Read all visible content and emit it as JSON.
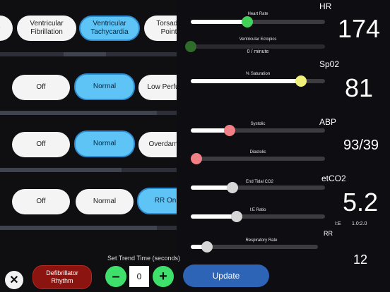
{
  "rhythm_row": {
    "options": [
      {
        "label": ")",
        "selected": false
      },
      {
        "label": "Ventricular\nFibrillation",
        "selected": false
      },
      {
        "label": "Ventricular\nTachycardia",
        "selected": true
      },
      {
        "label": "Torsade\nPoint",
        "selected": false
      }
    ]
  },
  "spo2_row": {
    "options": [
      {
        "label": "Off",
        "selected": false
      },
      {
        "label": "Normal",
        "selected": true
      },
      {
        "label": "Low Perfu",
        "selected": false
      }
    ]
  },
  "abp_row": {
    "options": [
      {
        "label": "Off",
        "selected": false
      },
      {
        "label": "Normal",
        "selected": true
      },
      {
        "label": "Overdam",
        "selected": false
      }
    ]
  },
  "co2_row": {
    "options": [
      {
        "label": "Off",
        "selected": false
      },
      {
        "label": "Normal",
        "selected": false
      },
      {
        "label": "RR On",
        "selected": true
      }
    ]
  },
  "vitals": {
    "hr": {
      "name": "HR",
      "value": "174",
      "slider_label": "Heart Rate",
      "slider_level": 0.42,
      "thumb_color": "#43d15a"
    },
    "ectopics": {
      "slider_label": "Ventricular Ectopics",
      "slider_level": 0.0,
      "readout": "0  / minute",
      "thumb_color": "#2f6b2a"
    },
    "spo2": {
      "name": "Sp02",
      "value": "81",
      "slider_label": "% Saturation",
      "slider_level": 0.82,
      "thumb_color": "#eef07a"
    },
    "abp": {
      "name": "ABP",
      "value": "93/39",
      "systolic_label": "Systolic",
      "systolic_level": 0.29,
      "diastolic_label": "Diastolic",
      "diastolic_level": 0.04,
      "thumb_color": "#f07f86"
    },
    "etco2": {
      "name": "etCO2",
      "value": "5.2",
      "slider_label": "End Tidal CO2",
      "slider_level": 0.31,
      "ie_label": "I:E Ratio",
      "ie_level": 0.34,
      "ie_caption": "I:E",
      "ie_value": "1.0:2.0",
      "thumb_color": "#d6d6d6"
    },
    "rr": {
      "name": "RR",
      "value": "12",
      "slider_label": "Respiratory Rate",
      "slider_level": 0.13,
      "thumb_color": "#d6d6d6"
    }
  },
  "bottom": {
    "close_symbol": "✕",
    "defib_label": "Defibrillator\nRhythm",
    "trend_label": "Set Trend Time (seconds)",
    "minus_symbol": "–",
    "trend_value": "0",
    "plus_symbol": "+",
    "update_label": "Update"
  },
  "colors": {
    "accent": "#5ec4f5",
    "update_button": "#2e64b6",
    "defib_button": "#8b1410",
    "stepper_button": "#3ee06b"
  }
}
